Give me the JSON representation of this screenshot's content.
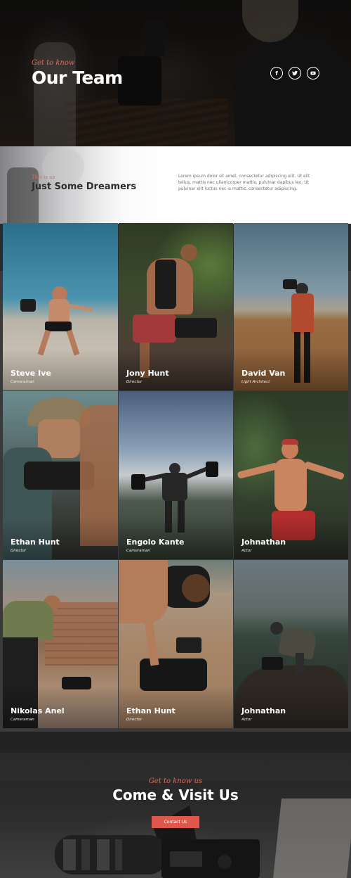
{
  "hero": {
    "eyebrow": "Get to know",
    "title": "Our Team",
    "social": [
      {
        "label": "f",
        "icon": "facebook-icon"
      },
      {
        "label": "t",
        "icon": "twitter-icon"
      },
      {
        "label": "y",
        "icon": "youtube-icon"
      }
    ]
  },
  "intro": {
    "eyebrow": "This is us",
    "title": "Just Some Dreamers",
    "text": "Lorem ipsum dolor sit amet, consectetur adipiscing elit. Ut elit tellus, mattis nec ullamcorper mattis, pulvinar dapibus leo. Ut pulvinar elit luctus nec is mattis, consectetur adipiscing."
  },
  "team": [
    {
      "name": "Steve Ive",
      "role": "Cameraman"
    },
    {
      "name": "Jony Hunt",
      "role": "Director"
    },
    {
      "name": "David Van",
      "role": "Light Architect"
    },
    {
      "name": "Ethan Hunt",
      "role": "Director"
    },
    {
      "name": "Engolo Kante",
      "role": "Cameraman"
    },
    {
      "name": "Johnathan",
      "role": "Actor"
    },
    {
      "name": "Nikolas Anel",
      "role": "Cameraman"
    },
    {
      "name": "Ethan Hunt",
      "role": "Director"
    },
    {
      "name": "Johnathan",
      "role": "Actor"
    }
  ],
  "cta": {
    "eyebrow": "Get to know us",
    "title": "Come & Visit Us",
    "button": "Contact Us"
  },
  "colors": {
    "accent": "#e0584c",
    "eyebrow": "#e06a5e",
    "dark_bg": "#2a2a2a"
  }
}
